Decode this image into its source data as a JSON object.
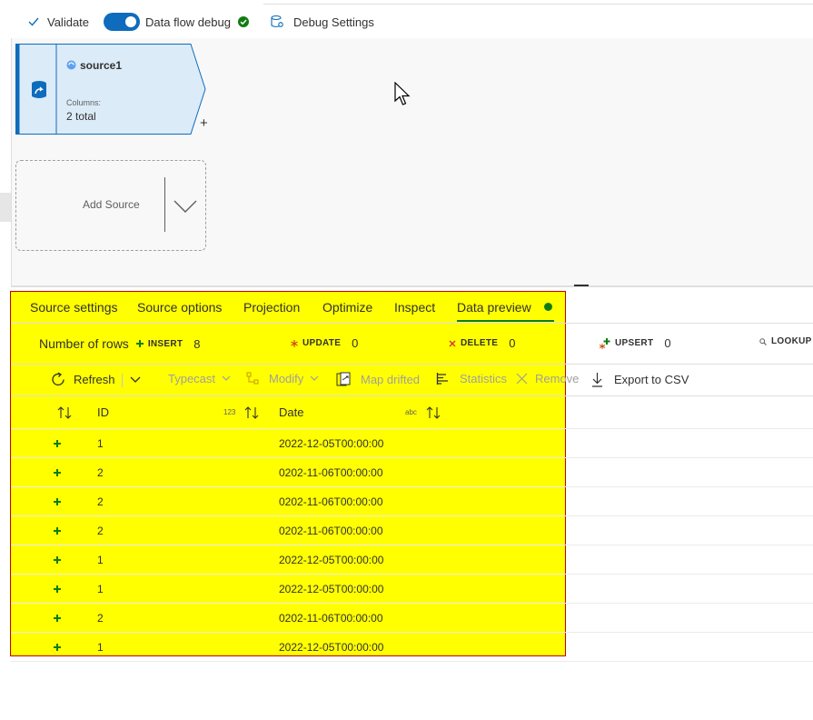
{
  "toolbar": {
    "validate_label": "Validate",
    "debug_label": "Data flow debug",
    "debug_settings_label": "Debug Settings"
  },
  "canvas": {
    "source_node": {
      "name": "source1",
      "columns_label": "Columns:",
      "columns_value": "2 total",
      "add_symbol": "+"
    },
    "add_source_label": "Add Source"
  },
  "panel": {
    "tabs": [
      {
        "label": "Source settings"
      },
      {
        "label": "Source options"
      },
      {
        "label": "Projection"
      },
      {
        "label": "Optimize"
      },
      {
        "label": "Inspect"
      },
      {
        "label": "Data preview"
      }
    ],
    "stats": {
      "rows_label": "Number of rows",
      "insert_label": "INSERT",
      "insert_value": "8",
      "update_label": "UPDATE",
      "update_value": "0",
      "delete_label": "DELETE",
      "delete_value": "0",
      "upsert_label": "UPSERT",
      "upsert_value": "0",
      "lookup_label": "LOOKUP"
    },
    "tools": {
      "refresh": "Refresh",
      "typecast": "Typecast",
      "modify": "Modify",
      "map_drifted": "Map drifted",
      "statistics": "Statistics",
      "remove": "Remove",
      "export": "Export to CSV"
    },
    "table": {
      "columns": [
        {
          "name": "ID",
          "type_badge": "123"
        },
        {
          "name": "Date",
          "type_badge": "abc"
        }
      ],
      "rows": [
        {
          "id": "1",
          "date": "2022-12-05T00:00:00"
        },
        {
          "id": "2",
          "date": "0202-11-06T00:00:00"
        },
        {
          "id": "2",
          "date": "0202-11-06T00:00:00"
        },
        {
          "id": "2",
          "date": "0202-11-06T00:00:00"
        },
        {
          "id": "1",
          "date": "2022-12-05T00:00:00"
        },
        {
          "id": "1",
          "date": "2022-12-05T00:00:00"
        },
        {
          "id": "2",
          "date": "0202-11-06T00:00:00"
        },
        {
          "id": "1",
          "date": "2022-12-05T00:00:00"
        }
      ]
    }
  },
  "colors": {
    "accent": "#0f6cbd",
    "success": "#107c10",
    "highlight": "#ffff00",
    "highlight_border": "#c00000",
    "node_fill": "#dcebf8"
  }
}
